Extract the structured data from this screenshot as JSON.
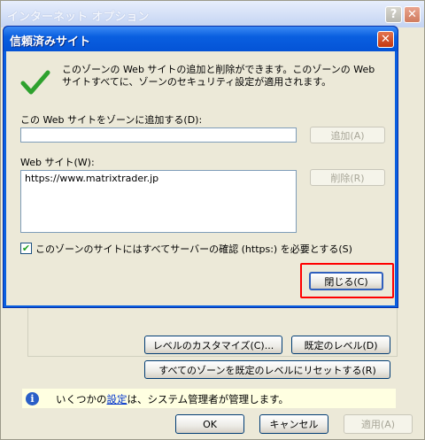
{
  "outer": {
    "title": "インターネット オプション",
    "help_label": "?",
    "close_label": "✕",
    "customize_level_label": "レベルのカスタマイズ(C)...",
    "default_level_label": "既定のレベル(D)",
    "reset_all_label": "すべてのゾーンを既定のレベルにリセットする(R)",
    "info_prefix": "いくつかの",
    "info_link": "設定",
    "info_suffix": "は、システム管理者が管理します。",
    "ok_label": "OK",
    "cancel_label": "キャンセル",
    "apply_label": "適用(A)"
  },
  "dialog": {
    "title": "信頼済みサイト",
    "close_label": "✕",
    "description": "このゾーンの Web サイトの追加と削除ができます。このゾーンの Web サイトすべてに、ゾーンのセキュリティ設定が適用されます。",
    "add_field_label": "この Web サイトをゾーンに追加する(D):",
    "add_field_value": "",
    "add_button_label": "追加(A)",
    "list_label": "Web サイト(W):",
    "sites": [
      "https://www.matrixtrader.jp"
    ],
    "remove_button_label": "削除(R)",
    "https_checkbox_label": "このゾーンのサイトにはすべてサーバーの確認 (https:) を必要とする(S)",
    "https_checked": true,
    "close_button_label": "閉じる(C)"
  },
  "colors": {
    "titlebar": "#0a5fe0",
    "window_bg": "#ece9d8",
    "highlight": "#ff0000",
    "info_bg": "#ffffe1",
    "checkmark": "#2ea12e"
  }
}
